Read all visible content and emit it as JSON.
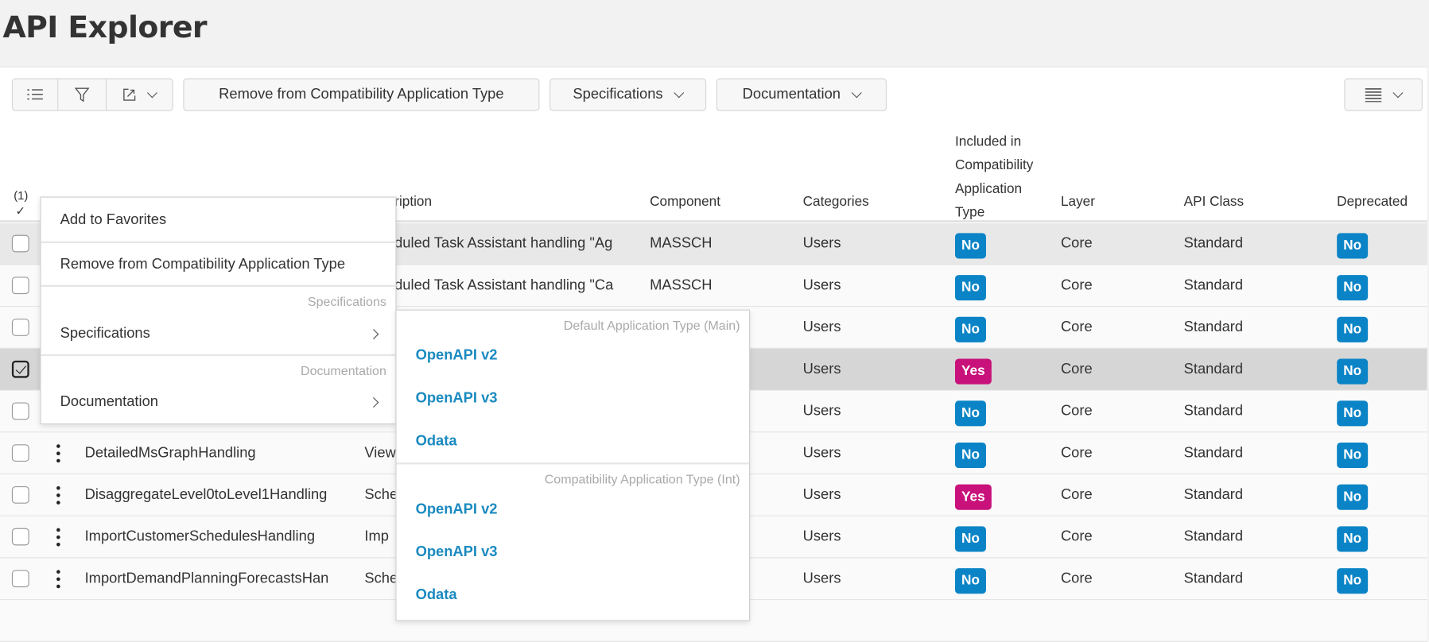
{
  "page_title": "API Explorer",
  "toolbar": {
    "icons": [
      "list-icon",
      "filter-icon",
      "export-icon"
    ],
    "remove_label": "Remove from Compatibility Application Type",
    "specifications_label": "Specifications",
    "documentation_label": "Documentation",
    "view_icon": "density-icon"
  },
  "table": {
    "selection_count": "(1)",
    "selection_check": "✓",
    "columns": {
      "description": "ription",
      "component": "Component",
      "categories": "Categories",
      "included": "Included in Compatibility Application Type",
      "layer": "Layer",
      "api_class": "API Class",
      "deprecated": "Deprecated"
    },
    "rows": [
      {
        "checked": false,
        "name": "",
        "description": "eduled Task Assistant handling \"Ag",
        "component": "MASSCH",
        "categories": "Users",
        "included": "No",
        "layer": "Core",
        "api_class": "Standard",
        "deprecated": "No"
      },
      {
        "checked": false,
        "name": "",
        "description": "eduled Task Assistant handling \"Ca",
        "component": "MASSCH",
        "categories": "Users",
        "included": "No",
        "layer": "Core",
        "api_class": "Standard",
        "deprecated": "No"
      },
      {
        "checked": false,
        "name": "",
        "description": "",
        "component": "",
        "categories": "Users",
        "included": "No",
        "layer": "Core",
        "api_class": "Standard",
        "deprecated": "No"
      },
      {
        "checked": true,
        "name": "",
        "description": "",
        "component": "",
        "categories": "Users",
        "included": "Yes",
        "layer": "Core",
        "api_class": "Standard",
        "deprecated": "No"
      },
      {
        "checked": false,
        "name": "",
        "description": "",
        "component": "",
        "categories": "Users",
        "included": "No",
        "layer": "Core",
        "api_class": "Standard",
        "deprecated": "No"
      },
      {
        "checked": false,
        "name": "DetailedMsGraphHandling",
        "description": "View",
        "component": "",
        "categories": "Users",
        "included": "No",
        "layer": "Core",
        "api_class": "Standard",
        "deprecated": "No"
      },
      {
        "checked": false,
        "name": "DisaggregateLevel0toLevel1Handling",
        "description": "Sche",
        "component": "",
        "categories": "Users",
        "included": "Yes",
        "layer": "Core",
        "api_class": "Standard",
        "deprecated": "No"
      },
      {
        "checked": false,
        "name": "ImportCustomerSchedulesHandling",
        "description": "Imp",
        "component": "",
        "categories": "Users",
        "included": "No",
        "layer": "Core",
        "api_class": "Standard",
        "deprecated": "No"
      },
      {
        "checked": false,
        "name": "ImportDemandPlanningForecastsHan",
        "description": "Sche",
        "component": "",
        "categories": "Users",
        "included": "No",
        "layer": "Core",
        "api_class": "Standard",
        "deprecated": "No"
      }
    ]
  },
  "context_menu": {
    "add_favorites": "Add to Favorites",
    "remove": "Remove from Compatibility Application Type",
    "spec_header": "Specifications",
    "spec_item": "Specifications",
    "doc_header": "Documentation",
    "doc_item": "Documentation"
  },
  "submenu": {
    "main_header": "Default Application Type (Main)",
    "main_items": [
      "OpenAPI v2",
      "OpenAPI v3",
      "Odata"
    ],
    "int_header": "Compatibility Application Type (Int)",
    "int_items": [
      "OpenAPI v2",
      "OpenAPI v3",
      "Odata"
    ]
  },
  "colors": {
    "no_badge": "#0a84c6",
    "yes_badge": "#c8117a",
    "link": "#1a8ac0"
  }
}
